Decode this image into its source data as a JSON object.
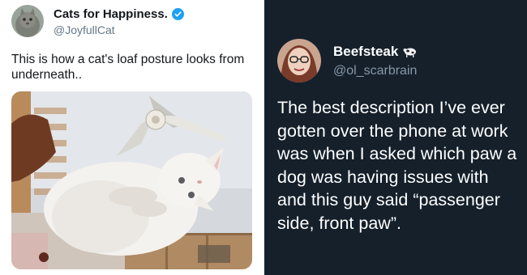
{
  "left_tweet": {
    "display_name": "Cats for Happiness.",
    "handle": "@JoyfullCat",
    "text": "This is how a cat's loaf posture looks from underneath..",
    "verified_icon": "verified-badge-icon",
    "theme_colors": {
      "background": "#ffffff",
      "text": "#14171a",
      "secondary": "#657786",
      "verified": "#1da1f2"
    }
  },
  "right_tweet": {
    "display_name": "Beefsteak",
    "handle": "@ol_scarbrain",
    "name_emoji_icon": "cow-icon",
    "text": "The best description I’ve ever gotten over the phone at work was when I asked which paw a dog was having issues with and this guy said “passenger side, front paw”.",
    "theme_colors": {
      "background": "#15202b",
      "text": "#ffffff",
      "secondary": "#8899a6"
    }
  }
}
